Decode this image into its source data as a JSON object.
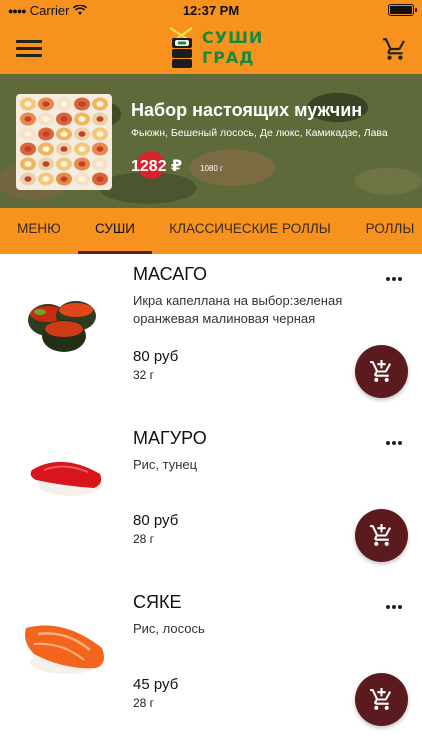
{
  "status_bar": {
    "carrier": "Carrier",
    "time": "12:37 PM"
  },
  "header": {
    "logo_line1": "СУШИ",
    "logo_line2": "ГРАД",
    "menu_icon": "hamburger-menu-icon",
    "cart_icon": "shopping-cart-icon"
  },
  "promo": {
    "title": "Набор настоящих мужчин",
    "description": "Фьюжн, Бешеный лосось, Де люкс, Камикадзе, Лава",
    "price": "1282 ₽",
    "weight": "1080 г"
  },
  "tabs": [
    {
      "label": "МЕНЮ"
    },
    {
      "label": "СУШИ"
    },
    {
      "label": "КЛАССИЧЕСКИЕ РОЛЛЫ"
    },
    {
      "label": "РОЛЛЫ"
    }
  ],
  "active_tab": "СУШИ",
  "items": [
    {
      "name": "МАСАГО",
      "description": "Икра капеллана на выбор:зеленая оранжевая малиновая черная",
      "price": "80 руб",
      "weight": "32 г"
    },
    {
      "name": "МАГУРО",
      "description": "Рис, тунец",
      "price": "80 руб",
      "weight": "28 г"
    },
    {
      "name": "СЯКЕ",
      "description": "Рис, лосось",
      "price": "45 руб",
      "weight": "28 г"
    }
  ],
  "colors": {
    "brand_orange": "#f7921e",
    "accent_maroon": "#5b1b1e",
    "logo_green": "#178b3c",
    "price_badge": "#d7232c"
  }
}
